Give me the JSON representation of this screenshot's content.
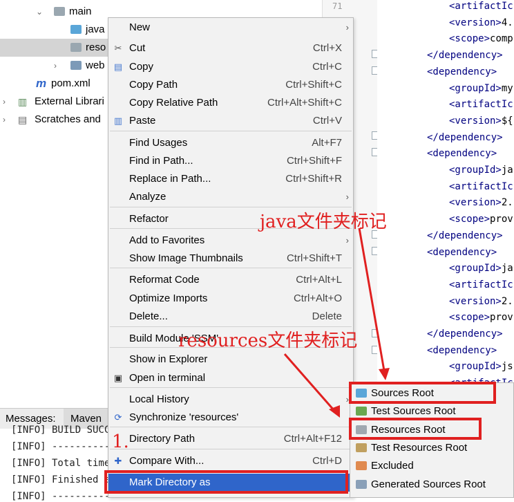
{
  "tree": {
    "items": [
      {
        "label": "main"
      },
      {
        "label": "java"
      },
      {
        "label": "reso"
      },
      {
        "label": "web"
      },
      {
        "label": "pom.xml"
      },
      {
        "label": "External Librari"
      },
      {
        "label": "Scratches and"
      }
    ]
  },
  "gutter": {
    "line_number": "71"
  },
  "editor": {
    "lines": [
      {
        "open": "<artifactIc",
        "text": ""
      },
      {
        "open": "<version>",
        "text": "4."
      },
      {
        "open": "<scope>",
        "text": "comp"
      },
      {
        "open": "</dependency>",
        "text": ""
      },
      {
        "open": "<dependency>",
        "text": ""
      },
      {
        "open": "<groupId>",
        "text": "my"
      },
      {
        "open": "<artifactIc",
        "text": ""
      },
      {
        "open": "<version>",
        "text": "${"
      },
      {
        "open": "</dependency>",
        "text": ""
      },
      {
        "open": "<dependency>",
        "text": ""
      },
      {
        "open": "<groupId>",
        "text": "ja"
      },
      {
        "open": "<artifactIc",
        "text": ""
      },
      {
        "open": "<version>",
        "text": "2."
      },
      {
        "open": "<scope>",
        "text": "prov"
      },
      {
        "open": "</dependency>",
        "text": ""
      },
      {
        "open": "<dependency>",
        "text": ""
      },
      {
        "open": "<groupId>",
        "text": "ja"
      },
      {
        "open": "<artifactIc",
        "text": ""
      },
      {
        "open": "<version>",
        "text": "2."
      },
      {
        "open": "<scope>",
        "text": "prov"
      },
      {
        "open": "</dependency>",
        "text": ""
      },
      {
        "open": "<dependency>",
        "text": ""
      },
      {
        "open": "<groupId>",
        "text": "js"
      },
      {
        "open": "<artifactIc",
        "text": ""
      }
    ]
  },
  "messages": {
    "tabs": [
      {
        "label": "Messages:"
      },
      {
        "label": "Maven"
      }
    ],
    "log": [
      "[INFO] BUILD SUCCE",
      "[INFO] -----------",
      "[INFO] Total time:",
      "[INFO] Finished a",
      "[INFO] -----------"
    ]
  },
  "menu": {
    "items": [
      {
        "label": "New",
        "shortcut": ""
      },
      {
        "label": "Cut",
        "shortcut": "Ctrl+X"
      },
      {
        "label": "Copy",
        "shortcut": "Ctrl+C"
      },
      {
        "label": "Copy Path",
        "shortcut": "Ctrl+Shift+C"
      },
      {
        "label": "Copy Relative Path",
        "shortcut": "Ctrl+Alt+Shift+C"
      },
      {
        "label": "Paste",
        "shortcut": "Ctrl+V"
      },
      {
        "label": "Find Usages",
        "shortcut": "Alt+F7"
      },
      {
        "label": "Find in Path...",
        "shortcut": "Ctrl+Shift+F"
      },
      {
        "label": "Replace in Path...",
        "shortcut": "Ctrl+Shift+R"
      },
      {
        "label": "Analyze",
        "shortcut": ""
      },
      {
        "label": "Refactor",
        "shortcut": ""
      },
      {
        "label": "Add to Favorites",
        "shortcut": ""
      },
      {
        "label": "Show Image Thumbnails",
        "shortcut": "Ctrl+Shift+T"
      },
      {
        "label": "Reformat Code",
        "shortcut": "Ctrl+Alt+L"
      },
      {
        "label": "Optimize Imports",
        "shortcut": "Ctrl+Alt+O"
      },
      {
        "label": "Delete...",
        "shortcut": "Delete"
      },
      {
        "label": "Build Module 'SSM'",
        "shortcut": ""
      },
      {
        "label": "Show in Explorer",
        "shortcut": ""
      },
      {
        "label": "Open in terminal",
        "shortcut": ""
      },
      {
        "label": "Local History",
        "shortcut": ""
      },
      {
        "label": "Synchronize 'resources'",
        "shortcut": ""
      },
      {
        "label": "Directory Path",
        "shortcut": "Ctrl+Alt+F12"
      },
      {
        "label": "Compare With...",
        "shortcut": "Ctrl+D"
      },
      {
        "label": "Mark Directory as",
        "shortcut": ""
      }
    ]
  },
  "submenu": {
    "items": [
      {
        "label": "Sources Root",
        "color": "#5aa6d8"
      },
      {
        "label": "Test Sources Root",
        "color": "#6aa84f"
      },
      {
        "label": "Resources Root",
        "color": "#a0a8b0"
      },
      {
        "label": "Test Resources Root",
        "color": "#c0a060"
      },
      {
        "label": "Excluded",
        "color": "#e08a50"
      },
      {
        "label": "Generated Sources Root",
        "color": "#8aa0b8"
      }
    ]
  },
  "annotations": {
    "java_mark": "java文件夹标记",
    "resources_mark": "resources文件夹标记",
    "step": "1."
  },
  "colors": {
    "highlight": "#2f65ca",
    "annotation_red": "#e02020",
    "folder_blue": "#5aa6d8",
    "folder_gray": "#a0a8b0"
  }
}
